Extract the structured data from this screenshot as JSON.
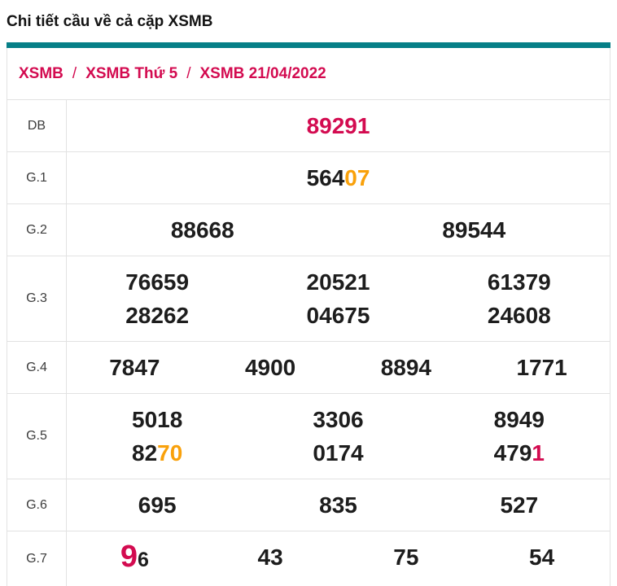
{
  "page": {
    "title": "Chi tiết cầu về cả cặp XSMB"
  },
  "breadcrumb": {
    "separator": "/",
    "items": [
      "XSMB",
      "XSMB Thứ 5",
      "XSMB 21/04/2022"
    ]
  },
  "colors": {
    "accent_teal": "#067f87",
    "crimson": "#d30b50",
    "orange": "#f9a10b",
    "number_text": "#1d1d1d",
    "label_text": "#3c3c3c",
    "border": "#e2e2e2"
  },
  "table": {
    "rows": [
      {
        "label": "DB",
        "lines": [
          [
            [
              {
                "t": "89291",
                "color": "crimson"
              }
            ]
          ]
        ]
      },
      {
        "label": "G.1",
        "lines": [
          [
            [
              {
                "t": "564"
              },
              {
                "t": "07",
                "color": "orange"
              }
            ]
          ]
        ]
      },
      {
        "label": "G.2",
        "lines": [
          [
            [
              {
                "t": "88668"
              }
            ],
            [
              {
                "t": "89544"
              }
            ]
          ]
        ]
      },
      {
        "label": "G.3",
        "lines": [
          [
            [
              {
                "t": "76659"
              }
            ],
            [
              {
                "t": "20521"
              }
            ],
            [
              {
                "t": "61379"
              }
            ]
          ],
          [
            [
              {
                "t": "28262"
              }
            ],
            [
              {
                "t": "04675"
              }
            ],
            [
              {
                "t": "24608"
              }
            ]
          ]
        ]
      },
      {
        "label": "G.4",
        "lines": [
          [
            [
              {
                "t": "7847"
              }
            ],
            [
              {
                "t": "4900"
              }
            ],
            [
              {
                "t": "8894"
              }
            ],
            [
              {
                "t": "1771"
              }
            ]
          ]
        ]
      },
      {
        "label": "G.5",
        "lines": [
          [
            [
              {
                "t": "5018"
              }
            ],
            [
              {
                "t": "3306"
              }
            ],
            [
              {
                "t": "8949"
              }
            ]
          ],
          [
            [
              {
                "t": "82"
              },
              {
                "t": "70",
                "color": "orange"
              }
            ],
            [
              {
                "t": "0174"
              }
            ],
            [
              {
                "t": "479"
              },
              {
                "t": "1",
                "color": "crimson"
              }
            ]
          ]
        ]
      },
      {
        "label": "G.6",
        "lines": [
          [
            [
              {
                "t": "695"
              }
            ],
            [
              {
                "t": "835"
              }
            ],
            [
              {
                "t": "527"
              }
            ]
          ]
        ]
      },
      {
        "label": "G.7",
        "lines": [
          [
            [
              {
                "t": "9",
                "color": "crimson",
                "size": "big"
              },
              {
                "t": "6",
                "size": "small"
              }
            ],
            [
              {
                "t": "43"
              }
            ],
            [
              {
                "t": "75"
              }
            ],
            [
              {
                "t": "54"
              }
            ]
          ]
        ]
      }
    ]
  }
}
